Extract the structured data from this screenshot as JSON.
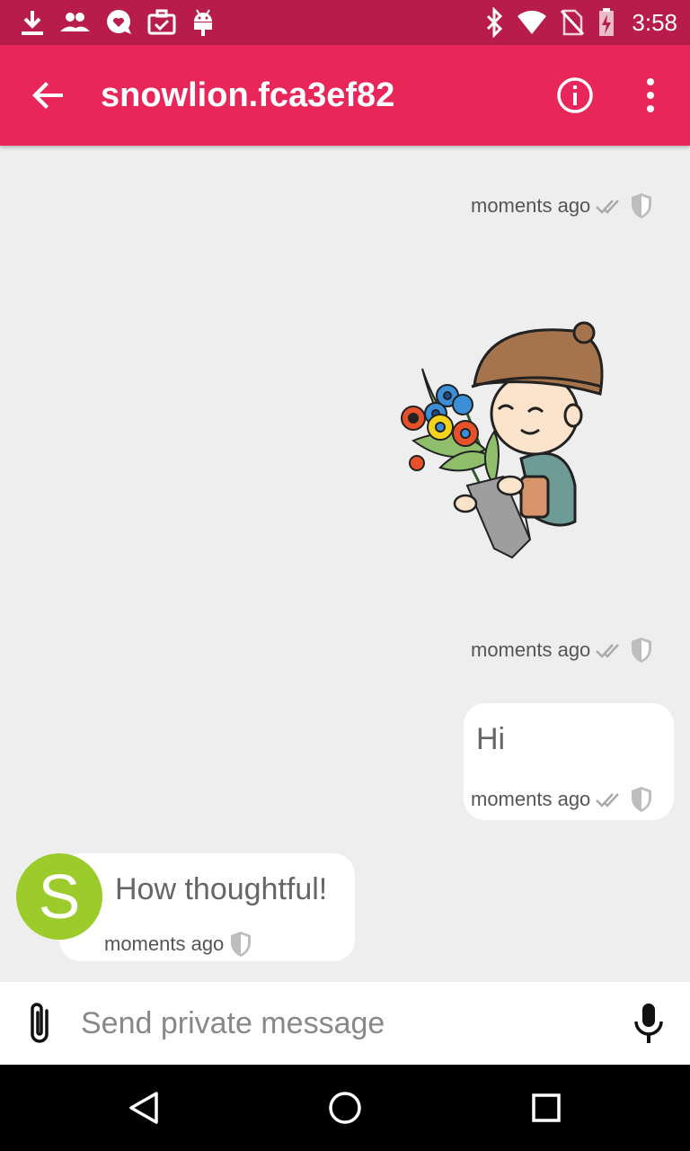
{
  "status_bar": {
    "time": "3:58",
    "left_icons": [
      "download-icon",
      "people-icon",
      "heart-chat-icon",
      "briefcase-check-icon",
      "android-icon"
    ],
    "right_icons": [
      "bluetooth-icon",
      "wifi-icon",
      "no-sim-icon",
      "battery-charging-icon"
    ]
  },
  "app_bar": {
    "title": "snowlion.fca3ef82",
    "background": "#e8265a",
    "status_background": "#b71c4b"
  },
  "messages": [
    {
      "id": "sent-1",
      "direction": "outgoing",
      "type": "meta-only",
      "timestamp": "moments ago"
    },
    {
      "id": "sent-sticker",
      "direction": "outgoing",
      "type": "sticker",
      "sticker": "boy-with-flowers",
      "timestamp": "moments ago"
    },
    {
      "id": "sent-hi",
      "direction": "outgoing",
      "type": "text",
      "text": "Hi",
      "timestamp": "moments ago"
    },
    {
      "id": "recv-1",
      "direction": "incoming",
      "type": "text",
      "text": "How thoughtful!",
      "timestamp": "moments ago",
      "avatar_letter": "S",
      "avatar_color": "#9ccc2c"
    }
  ],
  "composer": {
    "placeholder": "Send private message"
  }
}
